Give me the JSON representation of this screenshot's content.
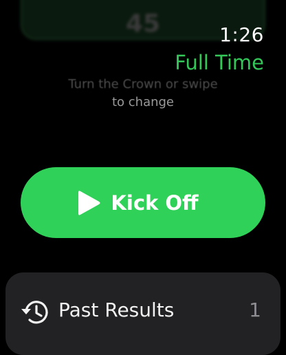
{
  "stepper": {
    "value": "45"
  },
  "status": {
    "time": "1:26",
    "mode": "Full Time"
  },
  "hint": {
    "line1": "Turn the Crown or swipe",
    "line2": "to change"
  },
  "kickoff_button": {
    "label": "Kick Off",
    "icon": "play-icon",
    "color": "#30d158"
  },
  "past_results": {
    "label": "Past Results",
    "count": "1",
    "icon": "history-icon"
  },
  "colors": {
    "accent": "#34c759",
    "button": "#30d158",
    "background": "#000000",
    "card": "#222224"
  }
}
